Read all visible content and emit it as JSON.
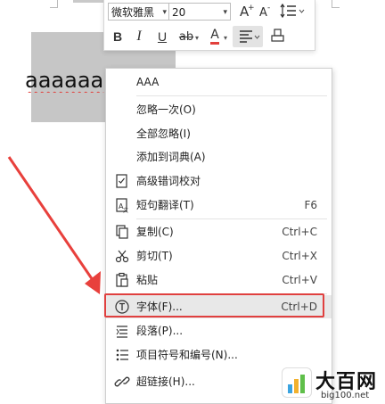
{
  "document": {
    "selected_text": "aaaaaa"
  },
  "mini_toolbar": {
    "font_name": "微软雅黑",
    "font_size": "20",
    "grow_font_icon": "A+",
    "shrink_font_icon": "A-",
    "bold": "B",
    "italic": "I",
    "underline": "U",
    "highlight": "ab",
    "font_color": "A"
  },
  "context_menu": {
    "items": [
      {
        "label": "AAA",
        "shortcut": ""
      },
      {
        "label": "忽略一次(O)",
        "shortcut": ""
      },
      {
        "label": "全部忽略(I)",
        "shortcut": ""
      },
      {
        "label": "添加到词典(A)",
        "shortcut": ""
      },
      {
        "label": "高级错词校对",
        "shortcut": ""
      },
      {
        "label": "短句翻译(T)",
        "shortcut": "F6"
      },
      {
        "label": "复制(C)",
        "shortcut": "Ctrl+C"
      },
      {
        "label": "剪切(T)",
        "shortcut": "Ctrl+X"
      },
      {
        "label": "粘贴",
        "shortcut": "Ctrl+V"
      },
      {
        "label": "字体(F)...",
        "shortcut": "Ctrl+D"
      },
      {
        "label": "段落(P)...",
        "shortcut": ""
      },
      {
        "label": "项目符号和编号(N)...",
        "shortcut": ""
      },
      {
        "label": "超链接(H)...",
        "shortcut": ""
      }
    ]
  },
  "watermark": {
    "title": "大百网",
    "url": "big100.net"
  },
  "colors": {
    "highlight_border": "#e0403f",
    "arrow": "#e8403c",
    "selection": "#c6c6c6",
    "font_color_underline": "#e2403c"
  }
}
